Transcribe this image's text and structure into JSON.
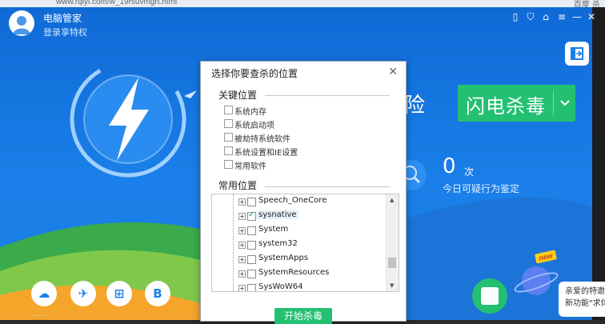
{
  "browser": {
    "url_text": "www.rqiyi.com/w_19rsuvmgrt.html",
    "right_text": "百度 杀"
  },
  "app": {
    "name": "电脑管家",
    "login_link": "登录享特权",
    "headline_partial": "险",
    "scan_button_label": "闪电杀毒",
    "count_value": "0",
    "count_unit": "次",
    "count_desc": "今日可疑行为鉴定",
    "new_badge": "new",
    "bubble_lines": [
      "亲爱的特邀",
      "新功能\"求体"
    ],
    "bottom_icons": [
      "cloud-icon",
      "bird-icon",
      "windows-icon",
      "b-icon"
    ],
    "bottom_labels": "······",
    "colors": {
      "primary": "#1a7fe8",
      "accent_green": "#23c072"
    }
  },
  "dialog": {
    "title": "选择你要查杀的位置",
    "key_section_title": "关键位置",
    "key_items": [
      "系统内存",
      "系统启动项",
      "被劫持系统软件",
      "系统设置和IE设置",
      "常用软件"
    ],
    "common_section_title": "常用位置",
    "tree_items": [
      {
        "label": "Speech_OneCore",
        "checked": false,
        "selected": false
      },
      {
        "label": "sysnative",
        "checked": true,
        "selected": true
      },
      {
        "label": "System",
        "checked": false,
        "selected": false
      },
      {
        "label": "system32",
        "checked": false,
        "selected": false
      },
      {
        "label": "SystemApps",
        "checked": false,
        "selected": false
      },
      {
        "label": "SystemResources",
        "checked": false,
        "selected": false
      },
      {
        "label": "SysWoW64",
        "checked": false,
        "selected": false
      }
    ],
    "start_button": "开始杀毒"
  }
}
